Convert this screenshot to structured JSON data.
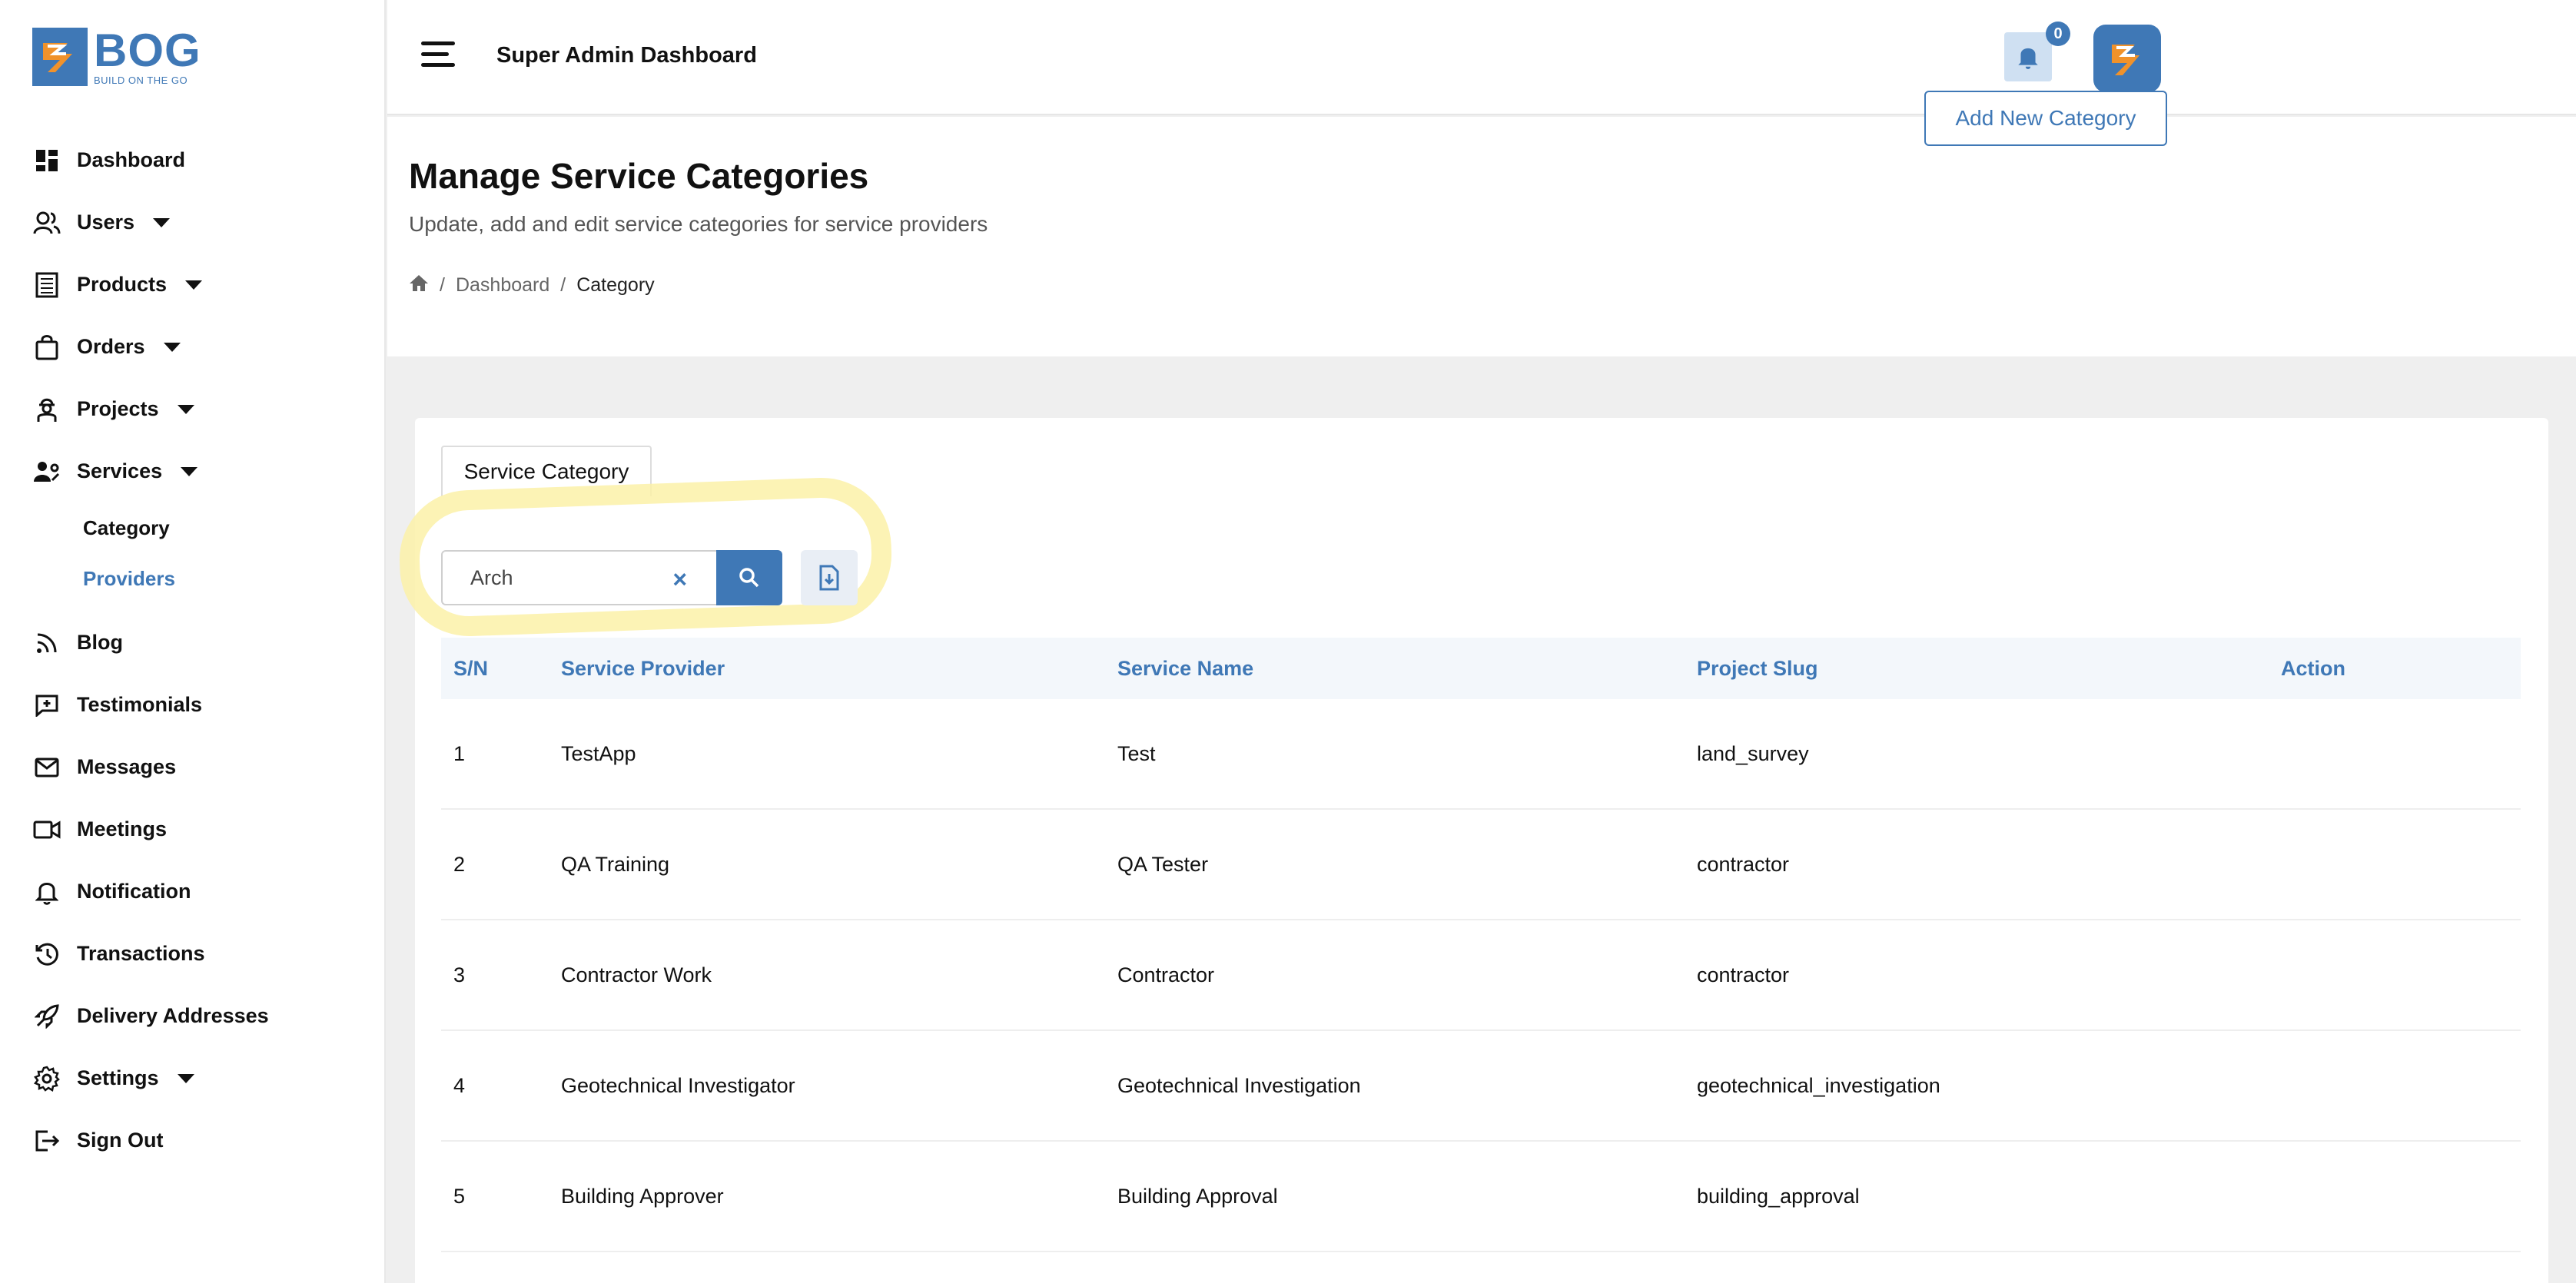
{
  "brand": {
    "name": "BOG",
    "tagline": "BUILD ON THE GO",
    "color": "#3f78b6",
    "accent": "#f0922b"
  },
  "sidebar": {
    "items": [
      {
        "label": "Dashboard",
        "icon": "dashboard-icon",
        "caret": false
      },
      {
        "label": "Users",
        "icon": "users-icon",
        "caret": true
      },
      {
        "label": "Products",
        "icon": "products-icon",
        "caret": true
      },
      {
        "label": "Orders",
        "icon": "shopping-bag-icon",
        "caret": true
      },
      {
        "label": "Projects",
        "icon": "worker-icon",
        "caret": true
      },
      {
        "label": "Services",
        "icon": "services-icon",
        "caret": true
      }
    ],
    "services_sub": [
      {
        "label": "Category"
      },
      {
        "label": "Providers"
      }
    ],
    "items2": [
      {
        "label": "Blog",
        "icon": "rss-icon"
      },
      {
        "label": "Testimonials",
        "icon": "testimonial-icon"
      },
      {
        "label": "Messages",
        "icon": "mail-icon"
      },
      {
        "label": "Meetings",
        "icon": "video-icon"
      },
      {
        "label": "Notification",
        "icon": "bell-icon"
      },
      {
        "label": "Transactions",
        "icon": "history-icon"
      },
      {
        "label": "Delivery Addresses",
        "icon": "rocket-icon"
      },
      {
        "label": "Settings",
        "icon": "gear-icon",
        "caret": true
      },
      {
        "label": "Sign Out",
        "icon": "sign-out-icon"
      }
    ]
  },
  "header": {
    "title": "Super Admin Dashboard",
    "notification_count": "0"
  },
  "page": {
    "title": "Manage Service Categories",
    "subtitle": "Update, add and edit service categories for service providers",
    "breadcrumb": [
      "Dashboard",
      "Category"
    ],
    "add_button": "Add New Category"
  },
  "card": {
    "tab": "Service Category",
    "search_value": "Arch",
    "clear_symbol": "×"
  },
  "table": {
    "headers": [
      "S/N",
      "Service Provider",
      "Service Name",
      "Project Slug",
      "Action"
    ],
    "rows": [
      [
        "1",
        "TestApp",
        "Test",
        "land_survey"
      ],
      [
        "2",
        "QA Training",
        "QA Tester",
        "contractor"
      ],
      [
        "3",
        "Contractor Work",
        "Contractor",
        "contractor"
      ],
      [
        "4",
        "Geotechnical Investigator",
        "Geotechnical Investigation",
        "geotechnical_investigation"
      ],
      [
        "5",
        "Building Approver",
        "Building Approval",
        "building_approval"
      ]
    ]
  }
}
